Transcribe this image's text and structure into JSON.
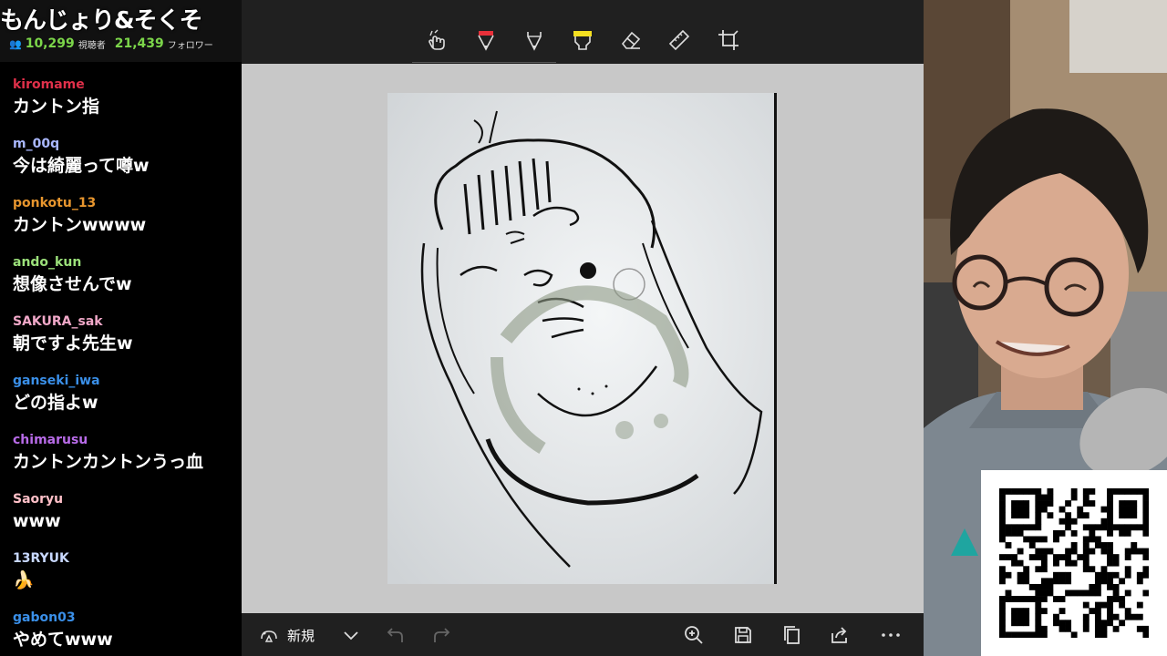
{
  "stream": {
    "title": "もんじょり&そくそ",
    "viewers": "10,299",
    "viewers_label": "視聴者",
    "followers": "21,439",
    "followers_label": "フォロワー"
  },
  "chat": [
    {
      "user": "kiromame",
      "color": "#e0304a",
      "text": "カントン指"
    },
    {
      "user": "m_00q",
      "color": "#aab8ff",
      "text": "今は綺麗って噂w"
    },
    {
      "user": "ponkotu_13",
      "color": "#e8962e",
      "text": "カントンwwww"
    },
    {
      "user": "ando_kun",
      "color": "#9be07a",
      "text": "想像させんでw"
    },
    {
      "user": "SAKURA_sak",
      "color": "#f0a8c8",
      "text": "朝ですよ先生w"
    },
    {
      "user": "ganseki_iwa",
      "color": "#3a8fe8",
      "text": "どの指よw"
    },
    {
      "user": "chimarusu",
      "color": "#b86be8",
      "text": "カントンカントンうっ血"
    },
    {
      "user": "Saoryu",
      "color": "#ffc0c8",
      "text": "www"
    },
    {
      "user": "13RYUK",
      "color": "#c8d8ff",
      "text": "🍌"
    },
    {
      "user": "gabon03",
      "color": "#3a8fe8",
      "text": "やめてwww"
    }
  ],
  "app": {
    "toolbar": {
      "tools": [
        "touch-writing-icon",
        "ballpoint-pen-icon",
        "pencil-icon",
        "highlighter-icon",
        "eraser-icon",
        "ruler-icon",
        "crop-icon"
      ],
      "pen_color": "#e8303a",
      "highlighter_color": "#f5e020"
    },
    "bottombar": {
      "new_label": "新規"
    }
  }
}
